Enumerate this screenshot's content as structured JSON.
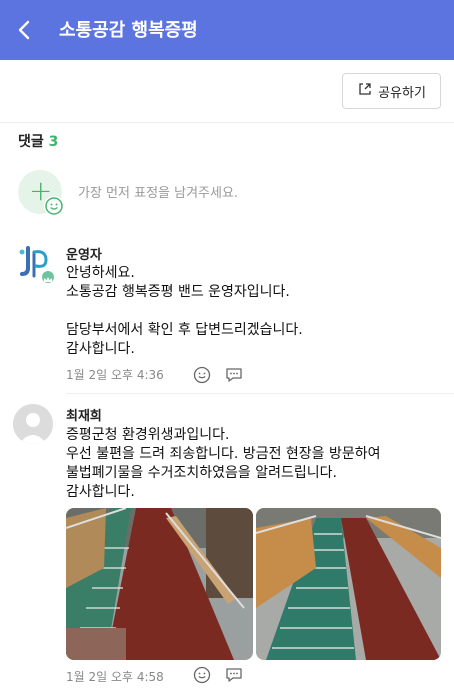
{
  "header": {
    "title": "소통공감 행복증평",
    "back_icon": "back-arrow-icon"
  },
  "share": {
    "label": "공유하기",
    "icon": "share-icon"
  },
  "comments": {
    "label": "댓글",
    "count": "3"
  },
  "add_comment": {
    "placeholder": "가장 먼저 표정을 남겨주세요."
  },
  "colors": {
    "header_bg": "#5b74e0",
    "accent_green": "#3fb36a"
  },
  "posts": [
    {
      "author": "운영자",
      "body": "안녕하세요.\n소통공감 행복증평 밴드 운영자입니다.\n\n담당부서에서 확인 후 답변드리겠습니다.\n감사합니다.",
      "time": "1월 2일 오후 4:36"
    },
    {
      "author": "최재희",
      "body": "증평군청 환경위생과입니다.\n우선 불편을 드려 죄송합니다. 방금전 현장을 방문하여\n불법폐기물을 수거조치하였음을 알려드립니다.\n감사합니다.",
      "time": "1월 2일 오후 4:58"
    }
  ]
}
